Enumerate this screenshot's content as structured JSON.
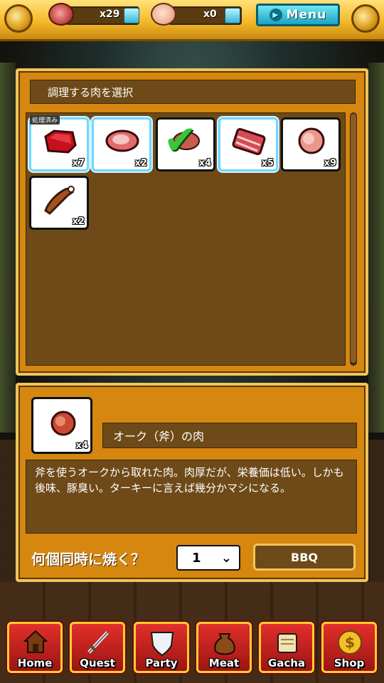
{
  "header": {
    "meat_count": "x29",
    "pig_count": "x0",
    "menu_label": "Menu"
  },
  "select_panel": {
    "title": "調理する肉を選択",
    "items": [
      {
        "qty": "x7",
        "badge": "処理済み",
        "icon": "raw-beef-icon",
        "selected": true
      },
      {
        "qty": "x2",
        "badge": "",
        "icon": "steak-icon",
        "selected": true
      },
      {
        "qty": "x4",
        "badge": "",
        "icon": "checkmark-icon",
        "selected": false
      },
      {
        "qty": "x5",
        "badge": "",
        "icon": "bacon-icon",
        "selected": true
      },
      {
        "qty": "x9",
        "badge": "",
        "icon": "ham-icon",
        "selected": false
      },
      {
        "qty": "x2",
        "badge": "",
        "icon": "drumstick-icon",
        "selected": false
      }
    ]
  },
  "detail_panel": {
    "selected_qty": "x4",
    "name": "オーク（斧）の肉",
    "description": "斧を使うオークから取れた肉。肉厚だが、栄養価は低い。しかも後味、豚臭い。ターキーに言えば幾分かマシになる。",
    "bake_question": "何個同時に焼く？",
    "quantity_value": "1",
    "bbq_label": "BBQ"
  },
  "nav": {
    "home": "Home",
    "quest": "Quest",
    "party": "Party",
    "meat": "Meat",
    "gacha": "Gacha",
    "shop": "Shop"
  },
  "colors": {
    "panel": "#d5870f",
    "panel_border": "#f2c35a",
    "inner_dark": "#6e4a18",
    "nav_red": "#c41f1b",
    "menu_cyan": "#1aa3c1"
  }
}
